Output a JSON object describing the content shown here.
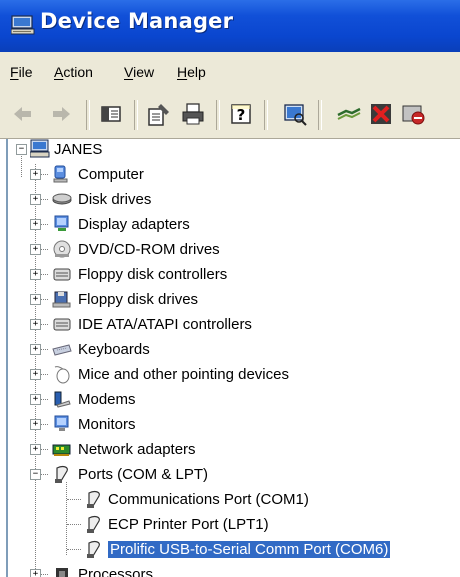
{
  "window": {
    "title": "Device Manager"
  },
  "menu": {
    "items": [
      "File",
      "Action",
      "View",
      "Help"
    ]
  },
  "toolbar": {
    "buttons": [
      "back-arrow-icon",
      "forward-arrow-icon",
      "show-hide-console-tree-icon",
      "properties-icon",
      "print-icon",
      "help-icon",
      "scan-hardware-icon",
      "update-driver-icon",
      "uninstall-icon",
      "disable-icon"
    ]
  },
  "tree": {
    "root": "JANES",
    "categories": [
      {
        "label": "Computer",
        "icon": "computer-icon",
        "expanded": false
      },
      {
        "label": "Disk drives",
        "icon": "disk-drive-icon",
        "expanded": false
      },
      {
        "label": "Display adapters",
        "icon": "display-adapter-icon",
        "expanded": false
      },
      {
        "label": "DVD/CD-ROM drives",
        "icon": "dvd-drive-icon",
        "expanded": false
      },
      {
        "label": "Floppy disk controllers",
        "icon": "controller-icon",
        "expanded": false
      },
      {
        "label": "Floppy disk drives",
        "icon": "floppy-drive-icon",
        "expanded": false
      },
      {
        "label": "IDE ATA/ATAPI controllers",
        "icon": "controller-icon",
        "expanded": false
      },
      {
        "label": "Keyboards",
        "icon": "keyboard-icon",
        "expanded": false
      },
      {
        "label": "Mice and other pointing devices",
        "icon": "mouse-icon",
        "expanded": false
      },
      {
        "label": "Modems",
        "icon": "modem-icon",
        "expanded": false
      },
      {
        "label": "Monitors",
        "icon": "monitor-icon",
        "expanded": false
      },
      {
        "label": "Network adapters",
        "icon": "network-adapter-icon",
        "expanded": false
      },
      {
        "label": "Ports (COM & LPT)",
        "icon": "port-icon",
        "expanded": true
      },
      {
        "label": "Processors",
        "icon": "processor-icon",
        "expanded": false
      }
    ],
    "ports_children": [
      {
        "label": "Communications Port (COM1)",
        "selected": false
      },
      {
        "label": "ECP Printer Port (LPT1)",
        "selected": false
      },
      {
        "label": "Prolific USB-to-Serial Comm Port (COM6)",
        "selected": true
      }
    ]
  },
  "colors": {
    "titlebar": "#0a46cf",
    "chrome": "#ece9d8",
    "selection": "#316ac5"
  }
}
